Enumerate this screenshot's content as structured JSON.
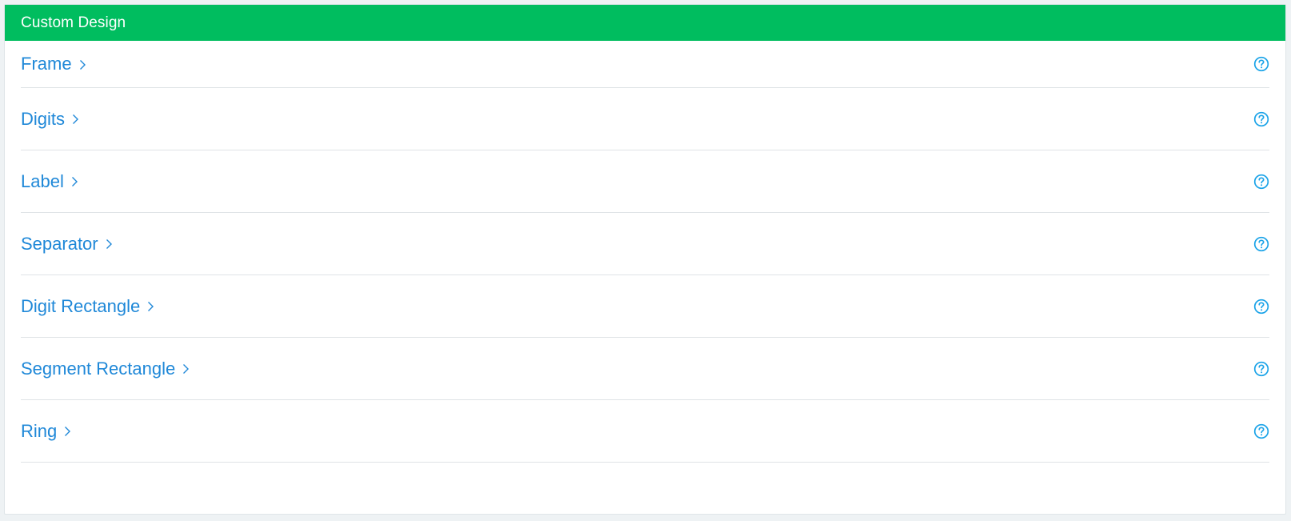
{
  "panel": {
    "title": "Custom Design"
  },
  "sections": [
    {
      "label": "Frame"
    },
    {
      "label": "Digits"
    },
    {
      "label": "Label"
    },
    {
      "label": "Separator"
    },
    {
      "label": "Digit Rectangle"
    },
    {
      "label": "Segment Rectangle"
    },
    {
      "label": "Ring"
    }
  ],
  "colors": {
    "header_bg": "#00bd5f",
    "link": "#1f88d8",
    "help_icon": "#1aa3e8"
  },
  "icons": {
    "expand": "chevron-right-icon",
    "help": "question-circle-icon"
  }
}
